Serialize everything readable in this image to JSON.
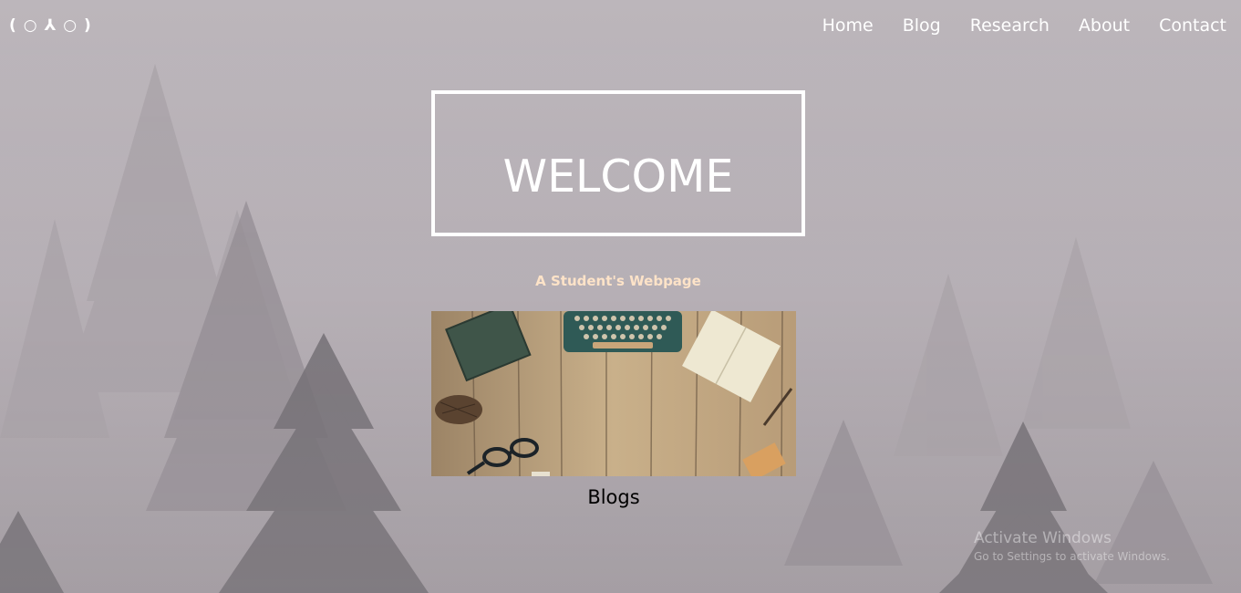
{
  "header": {
    "logo_text": "( ○ ⅄ ○ )"
  },
  "nav": {
    "items": [
      {
        "label": "Home"
      },
      {
        "label": "Blog"
      },
      {
        "label": "Research"
      },
      {
        "label": "About"
      },
      {
        "label": "Contact"
      }
    ]
  },
  "hero": {
    "title": "WELCOME",
    "subtitle": "A Student's Webpage"
  },
  "card": {
    "image_subject": "typewriter-desk-photo",
    "caption": "Blogs"
  },
  "watermark": {
    "title": "Activate Windows",
    "subtitle": "Go to Settings to activate Windows."
  },
  "colors": {
    "nav_text": "#ffffff",
    "subtitle_text": "#fde3c8",
    "caption_text": "#000000",
    "background_fog": "#b5aeb4",
    "frame_border": "#ffffff"
  }
}
